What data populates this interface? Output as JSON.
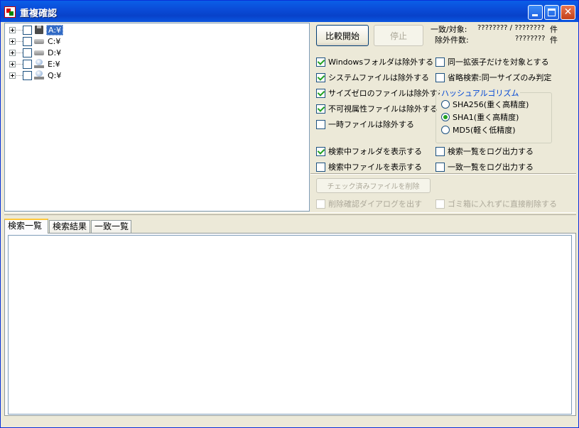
{
  "window": {
    "title": "重複確認"
  },
  "tree": {
    "drives": [
      {
        "label": "A:¥",
        "icon": "floppy-drive-icon",
        "selected": true
      },
      {
        "label": "C:¥",
        "icon": "hard-drive-icon",
        "selected": false
      },
      {
        "label": "D:¥",
        "icon": "hard-drive-icon",
        "selected": false
      },
      {
        "label": "E:¥",
        "icon": "network-drive-icon",
        "selected": false
      },
      {
        "label": "Q:¥",
        "icon": "network-drive-icon",
        "selected": false
      }
    ]
  },
  "controls": {
    "start_label": "比較開始",
    "stop_label": "停止",
    "stop_enabled": false,
    "match_label": "一致/対象:",
    "match_value": "???????? / ????????",
    "match_unit": "件",
    "excluded_label": "除外件数:",
    "excluded_value": "????????",
    "excluded_unit": "件"
  },
  "options": {
    "exclude_windows": {
      "label": "Windowsフォルダは除外する",
      "checked": true
    },
    "exclude_system": {
      "label": "システムファイルは除外する",
      "checked": true
    },
    "exclude_zero": {
      "label": "サイズゼロのファイルは除外する",
      "checked": true
    },
    "exclude_hidden": {
      "label": "不可視属性ファイルは除外する",
      "checked": true
    },
    "exclude_temp": {
      "label": "一時ファイルは除外する",
      "checked": false
    },
    "same_ext": {
      "label": "同一拡張子だけを対象とする",
      "checked": false
    },
    "quick_search": {
      "label": "省略検索:同一サイズのみ判定",
      "checked": false
    },
    "show_folder": {
      "label": "検索中フォルダを表示する",
      "checked": true
    },
    "show_file": {
      "label": "検索中ファイルを表示する",
      "checked": false
    },
    "log_search": {
      "label": "検索一覧をログ出力する",
      "checked": false
    },
    "log_match": {
      "label": "一致一覧をログ出力する",
      "checked": false
    }
  },
  "hash": {
    "title": "ハッシュアルゴリズム",
    "options": [
      {
        "label": "SHA256(重く高精度)",
        "checked": false
      },
      {
        "label": "SHA1(重く高精度)",
        "checked": true
      },
      {
        "label": "MD5(軽く低精度)",
        "checked": false
      }
    ]
  },
  "delete": {
    "button_label": "チェック済みファイルを削除",
    "confirm_label": "削除確認ダイアログを出す",
    "direct_label": "ゴミ箱に入れずに直接削除する",
    "enabled": false
  },
  "tabs": [
    {
      "label": "検索一覧",
      "active": true
    },
    {
      "label": "検索結果",
      "active": false
    },
    {
      "label": "一致一覧",
      "active": false
    }
  ],
  "colors": {
    "accent": "#0a4ad6",
    "selection": "#316ac5",
    "check": "#21a121"
  }
}
